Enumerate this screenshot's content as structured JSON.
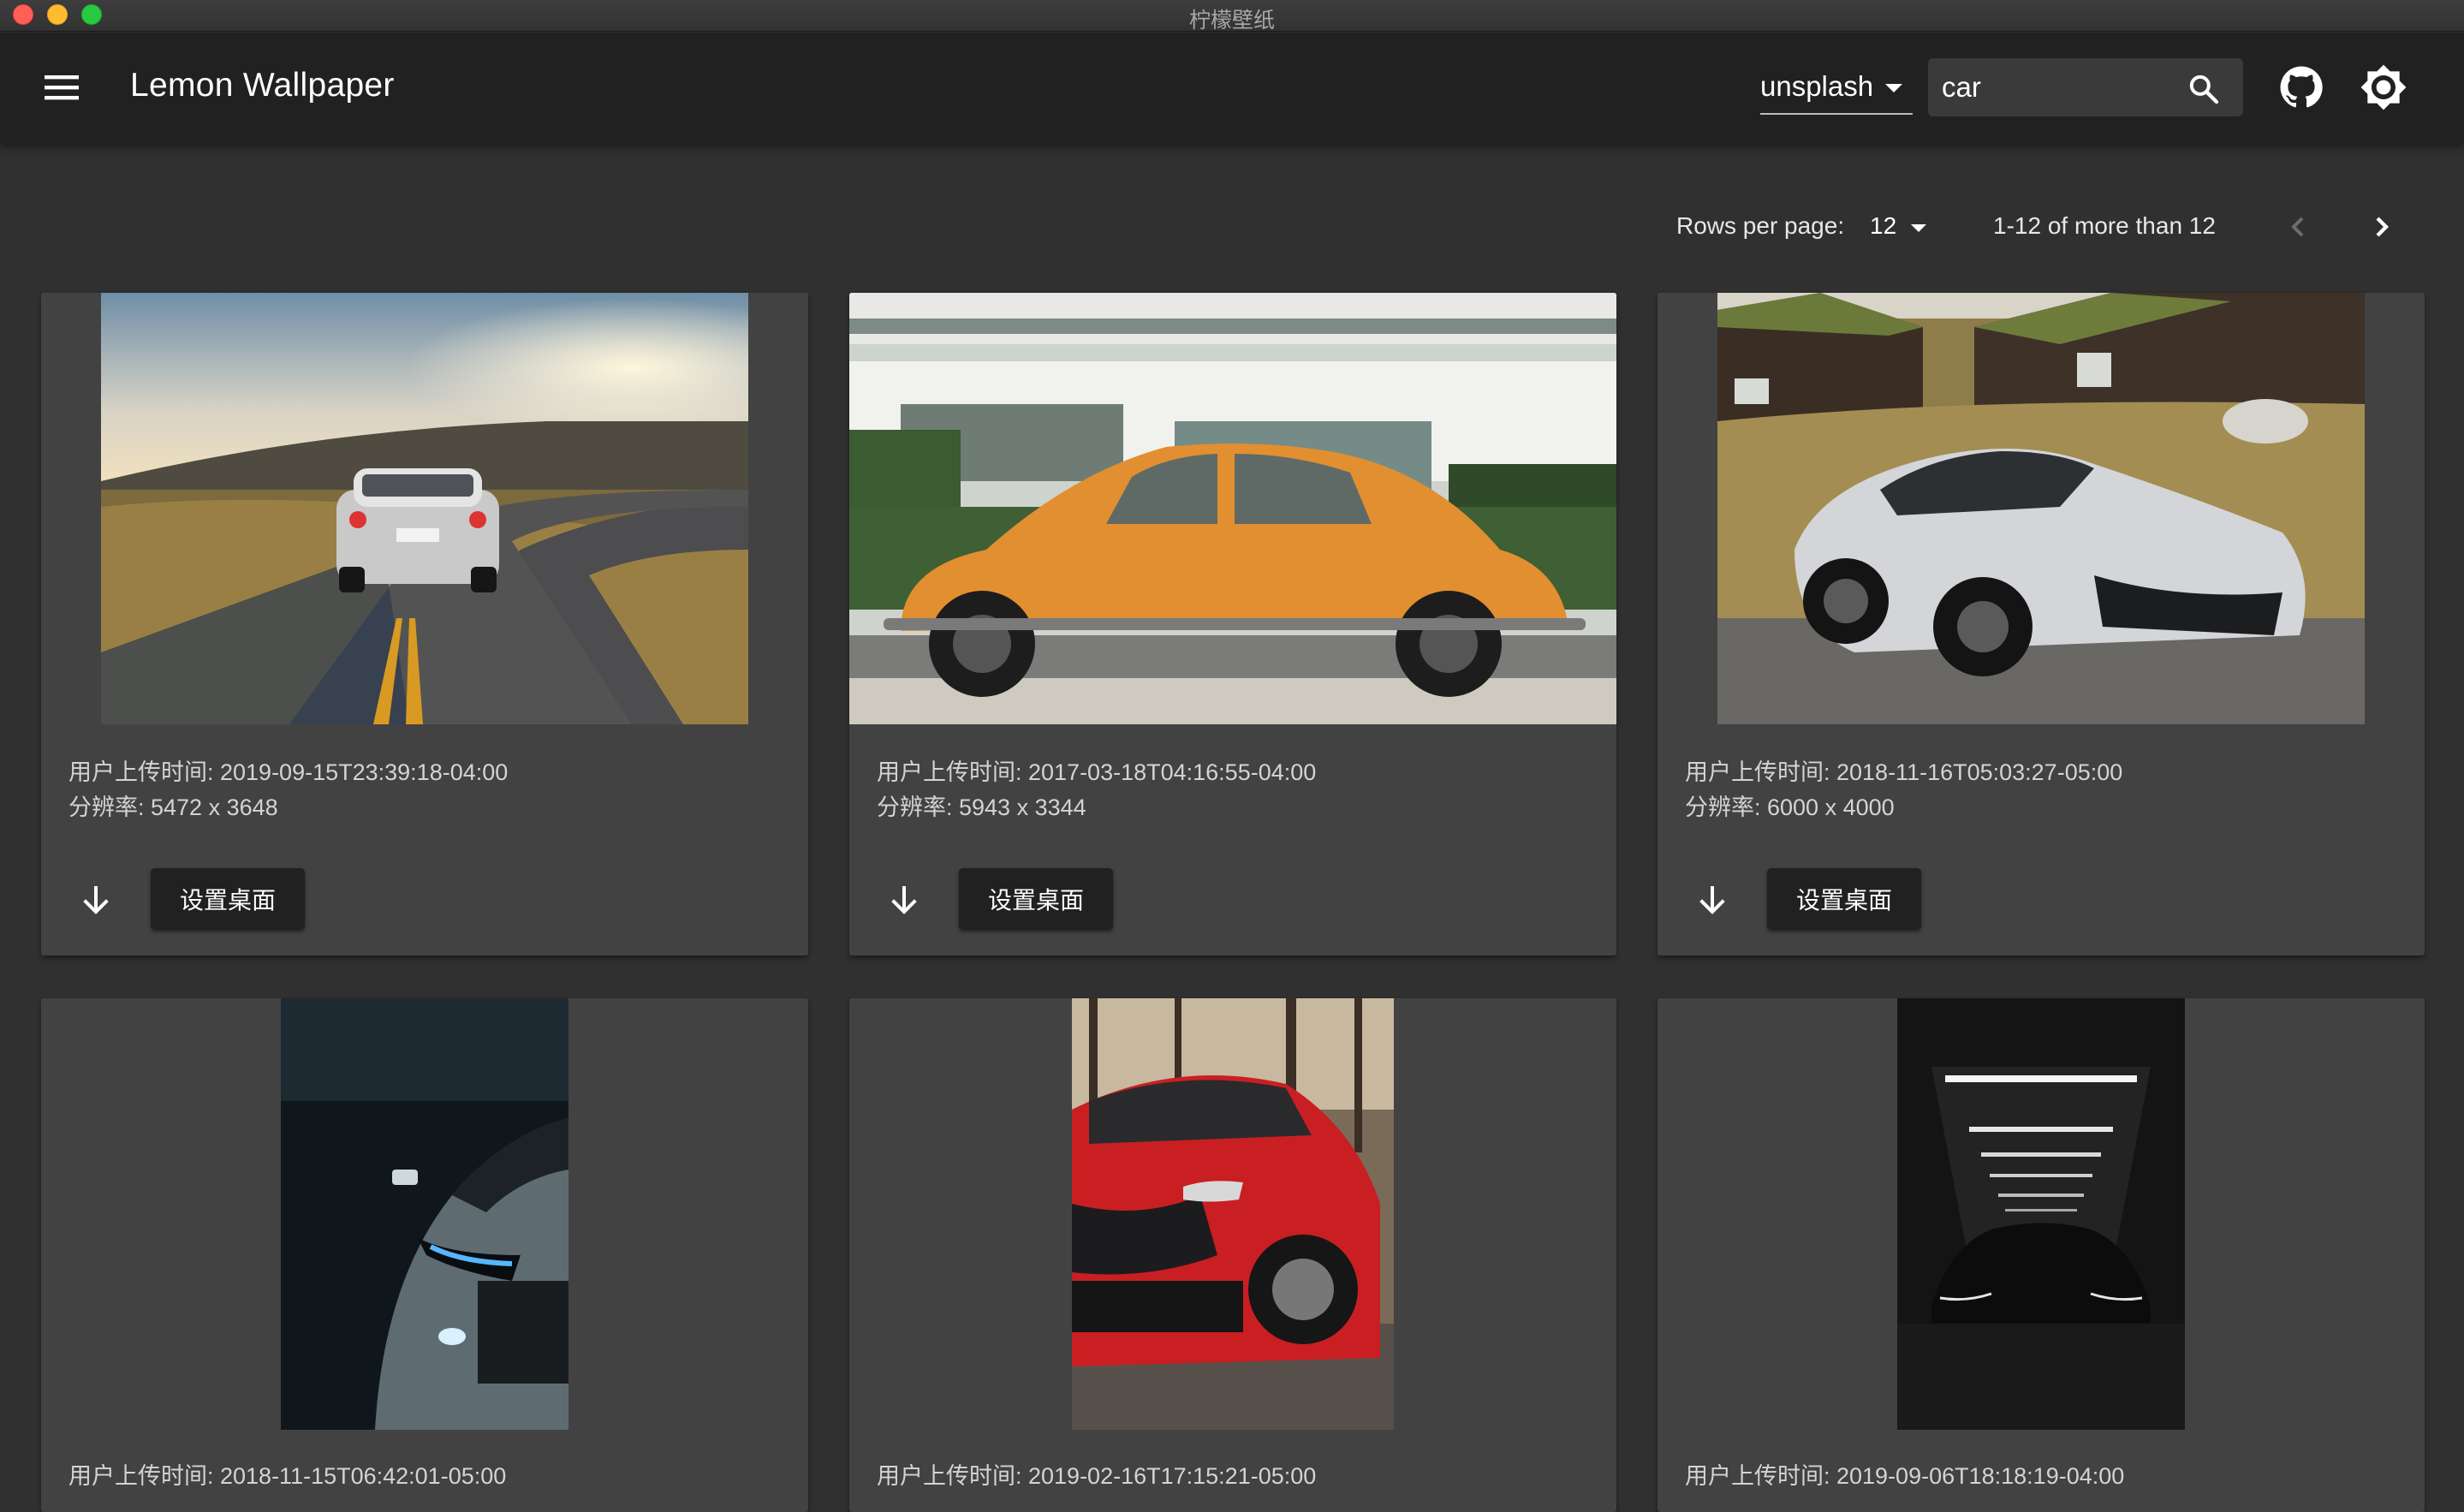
{
  "window": {
    "title": "柠檬壁纸"
  },
  "appbar": {
    "title": "Lemon Wallpaper",
    "source": "unsplash",
    "search_value": "car"
  },
  "pagination": {
    "rows_label": "Rows per page:",
    "rows_value": "12",
    "range_label": "1-12 of more than 12"
  },
  "cards": [
    {
      "upload_time": "用户上传时间: 2019-09-15T23:39:18-04:00",
      "resolution": "分辨率: 5472 x 3648",
      "set_label": "设置桌面"
    },
    {
      "upload_time": "用户上传时间: 2017-03-18T04:16:55-04:00",
      "resolution": "分辨率: 5943 x 3344",
      "set_label": "设置桌面"
    },
    {
      "upload_time": "用户上传时间: 2018-11-16T05:03:27-05:00",
      "resolution": "分辨率: 6000 x 4000",
      "set_label": "设置桌面"
    },
    {
      "upload_time": "用户上传时间: 2018-11-15T06:42:01-05:00"
    },
    {
      "upload_time": "用户上传时间: 2019-02-16T17:15:21-05:00"
    },
    {
      "upload_time": "用户上传时间: 2019-09-06T18:18:19-04:00"
    }
  ],
  "colors": {
    "background": "#303030",
    "appbar": "#212121",
    "card": "#424242",
    "button": "#212121"
  },
  "icons": [
    "menu-icon",
    "chevron-down-icon",
    "search-icon",
    "github-icon",
    "brightness-icon",
    "chevron-left-icon",
    "chevron-right-icon",
    "download-icon"
  ]
}
